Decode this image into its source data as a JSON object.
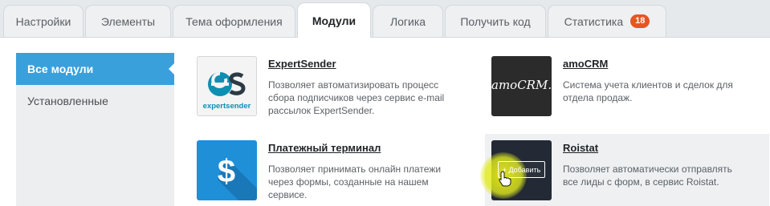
{
  "tabs": [
    {
      "label": "Настройки",
      "active": false
    },
    {
      "label": "Элементы",
      "active": false
    },
    {
      "label": "Тема оформления",
      "active": false
    },
    {
      "label": "Модули",
      "active": true
    },
    {
      "label": "Логика",
      "active": false
    },
    {
      "label": "Получить код",
      "active": false
    },
    {
      "label": "Статистика",
      "active": false,
      "badge": "18"
    }
  ],
  "sidebar": {
    "items": [
      {
        "label": "Все модули",
        "active": true
      },
      {
        "label": "Установленные",
        "active": false
      }
    ]
  },
  "modules": [
    {
      "title": "ExpertSender",
      "description": "Позволяет автоматизировать процесс сбора подписчиков через сервис e-mail рассылок ExpertSender.",
      "logo_icon": "expertsender-logo-icon",
      "logo_text": "expertsender"
    },
    {
      "title": "amoCRM",
      "description": "Система учета клиентов и сделок для отдела продаж.",
      "logo_icon": "amocrm-logo-icon",
      "logo_text": "amoCRM."
    },
    {
      "title": "Платежный терминал",
      "description": "Позволяет принимать онлайн платежи через формы, созданные на нашем сервисе.",
      "logo_icon": "dollar-icon"
    },
    {
      "title": "Roistat",
      "description": "Позволяет автоматически отправлять все лиды с форм, в сервис Roistat.",
      "logo_icon": "roistat-logo-icon",
      "add_label": "+ Добавить"
    }
  ],
  "colors": {
    "accent_blue": "#3aa0dc",
    "badge_orange": "#e8551f",
    "expertsender_teal": "#0d8fb1",
    "payment_blue": "#1f8fd8"
  }
}
